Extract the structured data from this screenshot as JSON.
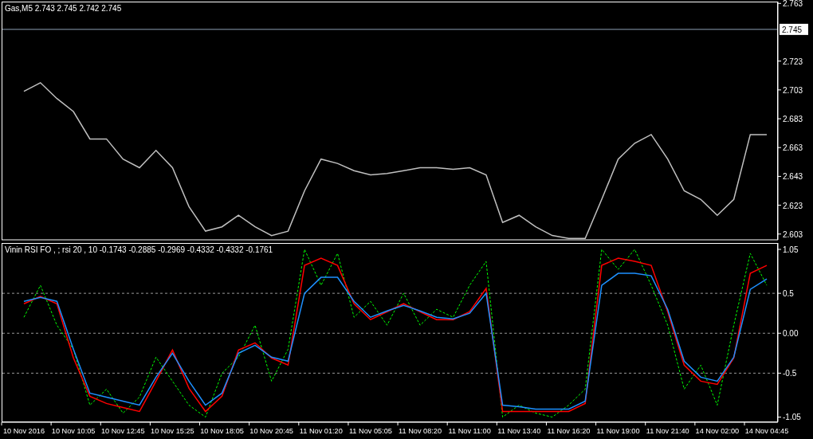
{
  "price_panel": {
    "title": "Gas,M5  2.743 2.745 2.742 2.745",
    "chart_data": {
      "type": "line",
      "ylim": [
        2.599,
        2.764
      ],
      "ref_lines": [
        {
          "axis": "y",
          "value": 2.745,
          "label": "2.745",
          "color": "#8ea0b4"
        }
      ],
      "yticks": [
        {
          "value": 2.763,
          "label": "2.763"
        },
        {
          "value": 2.723,
          "label": "2.723"
        },
        {
          "value": 2.703,
          "label": "2.703"
        },
        {
          "value": 2.683,
          "label": "2.683"
        },
        {
          "value": 2.663,
          "label": "2.663"
        },
        {
          "value": 2.643,
          "label": "2.643"
        },
        {
          "value": 2.623,
          "label": "2.623"
        },
        {
          "value": 2.603,
          "label": "2.603"
        }
      ],
      "series": [
        {
          "color": "#c0c0c0",
          "values": [
            2.702,
            2.708,
            2.697,
            2.688,
            2.669,
            2.669,
            2.655,
            2.649,
            2.661,
            2.649,
            2.622,
            2.605,
            2.608,
            2.616,
            2.608,
            2.602,
            2.605,
            2.633,
            2.655,
            2.652,
            2.647,
            2.644,
            2.645,
            2.647,
            2.649,
            2.649,
            2.648,
            2.649,
            2.644,
            2.611,
            2.616,
            2.608,
            2.602,
            2.6,
            2.6,
            2.627,
            2.655,
            2.666,
            2.672,
            2.655,
            2.633,
            2.627,
            2.616,
            2.627,
            2.672,
            2.672
          ]
        }
      ]
    }
  },
  "indicator_panel": {
    "title": "Vinin RSI FO , ; rsi 20 , 10  -0.1743 -0.2885 -0.2969 -0.4332 -0.4332 -0.1761",
    "chart_data": {
      "type": "line",
      "ylim": [
        -1.11,
        1.125
      ],
      "grid": true,
      "categories": [
        "10 Nov 2016",
        null,
        null,
        "10 Nov 10:05",
        null,
        null,
        "10 Nov 12:45",
        null,
        null,
        "10 Nov 15:25",
        null,
        null,
        "10 Nov 18:05",
        null,
        null,
        "10 Nov 20:45",
        null,
        null,
        "11 Nov 01:20",
        null,
        null,
        "11 Nov 05:05",
        null,
        null,
        "11 Nov 08:20",
        null,
        null,
        "11 Nov 11:00",
        null,
        null,
        "11 Nov 13:40",
        null,
        null,
        "11 Nov 16:20",
        null,
        null,
        "11 Nov 19:00",
        null,
        null,
        "11 Nov 21:40",
        null,
        null,
        "14 Nov 02:00",
        null,
        null,
        "14 Nov 04:45"
      ],
      "yticks": [
        {
          "value": 1.05,
          "label": "1.05"
        },
        {
          "value": 0.5,
          "label": "0.5"
        },
        {
          "value": 0,
          "label": "0.00"
        },
        {
          "value": -0.5,
          "label": "-0.5"
        },
        {
          "value": -1.05,
          "label": "-1.05"
        }
      ],
      "series": [
        {
          "color": "#00ff00",
          "line_style": "dashed",
          "values": [
            0.2,
            0.6,
            0.1,
            -0.2,
            -0.9,
            -0.7,
            -1.0,
            -0.8,
            -0.3,
            -0.6,
            -0.9,
            -1.05,
            -0.5,
            -0.3,
            0.1,
            -0.6,
            -0.2,
            1.05,
            0.6,
            1.0,
            0.2,
            0.4,
            0.1,
            0.5,
            0.1,
            0.3,
            0.2,
            0.6,
            0.9,
            -1.05,
            -0.9,
            -1.0,
            -1.05,
            -0.9,
            -0.7,
            1.05,
            0.8,
            1.05,
            0.6,
            0.1,
            -0.7,
            -0.4,
            -0.9,
            0.1,
            1.0,
            0.6
          ]
        },
        {
          "color": "#ff0000",
          "values": [
            0.37,
            0.46,
            0.37,
            -0.31,
            -0.79,
            -0.88,
            -0.93,
            -0.98,
            -0.6,
            -0.21,
            -0.69,
            -0.98,
            -0.79,
            -0.21,
            -0.12,
            -0.31,
            -0.4,
            0.85,
            0.94,
            0.85,
            0.37,
            0.17,
            0.27,
            0.37,
            0.27,
            0.17,
            0.17,
            0.27,
            0.56,
            -0.98,
            -0.98,
            -0.98,
            -0.98,
            -0.98,
            -0.88,
            0.85,
            0.94,
            0.9,
            0.85,
            0.27,
            -0.4,
            -0.6,
            -0.64,
            -0.31,
            0.75,
            0.85
          ]
        },
        {
          "color": "#1e90ff",
          "values": [
            0.4,
            0.45,
            0.4,
            -0.2,
            -0.75,
            -0.8,
            -0.85,
            -0.9,
            -0.55,
            -0.25,
            -0.6,
            -0.9,
            -0.75,
            -0.25,
            -0.15,
            -0.3,
            -0.35,
            0.5,
            0.7,
            0.7,
            0.4,
            0.2,
            0.28,
            0.35,
            0.28,
            0.2,
            0.18,
            0.25,
            0.5,
            -0.9,
            -0.92,
            -0.95,
            -0.95,
            -0.95,
            -0.85,
            0.6,
            0.75,
            0.75,
            0.72,
            0.3,
            -0.35,
            -0.55,
            -0.6,
            -0.3,
            0.55,
            0.68
          ]
        }
      ]
    }
  }
}
